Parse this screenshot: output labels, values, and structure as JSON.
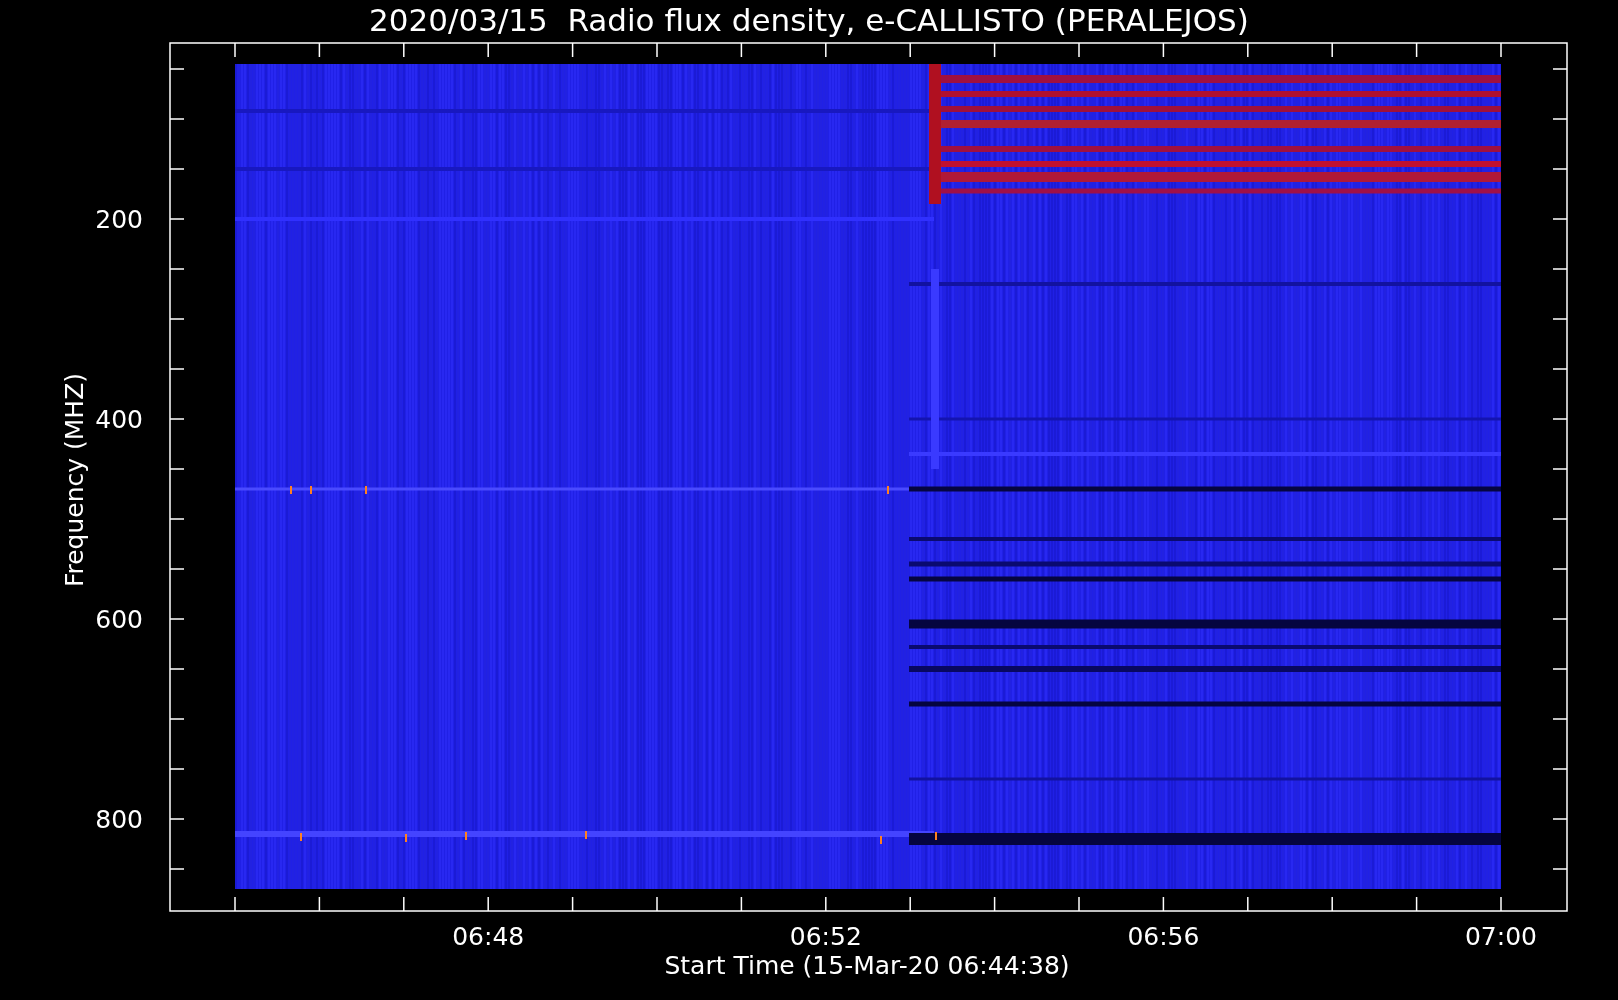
{
  "title": "2020/03/15  Radio flux density, e-CALLISTO (PERALEJOS)",
  "ylabel": "Frequency (MHZ)",
  "yticks": [
    "200",
    "400",
    "600",
    "800"
  ],
  "xticks": [
    "06:48",
    "06:52",
    "06:56",
    "07:00"
  ],
  "xlabel": "Start Time (15-Mar-20 06:44:38)"
}
